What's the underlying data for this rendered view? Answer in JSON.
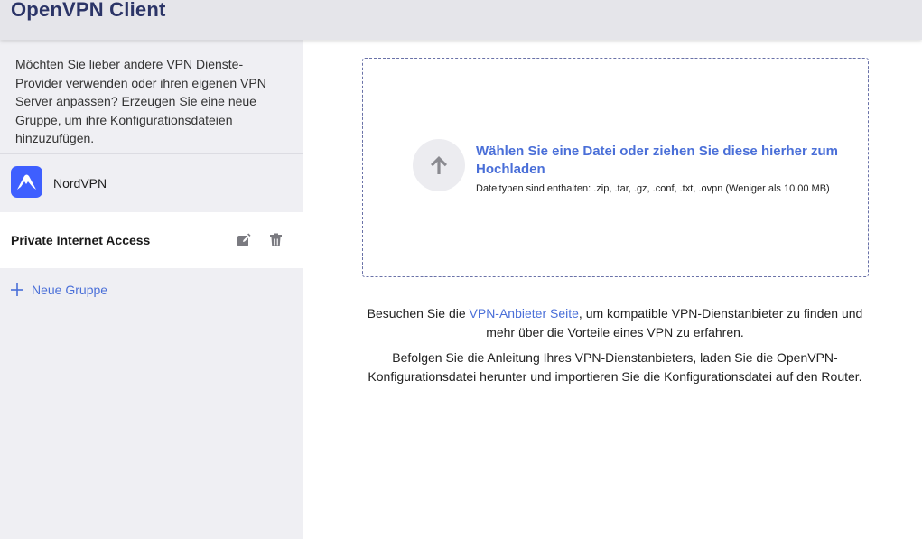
{
  "app": {
    "title": "OpenVPN Client"
  },
  "sidebar": {
    "intro": "Möchten Sie lieber andere VPN Dienste-Provider verwenden oder ihren eigenen VPN Server anpassen? Erzeugen Sie eine neue Gruppe, um ihre Konfigurationsdateien hinzuzufügen.",
    "groups": [
      {
        "label": "NordVPN",
        "icon": "nordvpn-logo-icon",
        "selected": false
      },
      {
        "label": "Private Internet Access",
        "selected": true,
        "actions": [
          "edit-icon",
          "trash-icon"
        ]
      }
    ],
    "new_group_label": "Neue Gruppe"
  },
  "upload": {
    "title": "Wählen Sie eine Datei oder ziehen Sie diese hierher zum Hochladen",
    "filetypes": "Dateitypen sind enthalten: .zip, .tar, .gz, .conf, .txt, .ovpn (Weniger als 10.00 MB)",
    "icon": "arrow-up-icon"
  },
  "info": {
    "line1_prefix": "Besuchen Sie die ",
    "line1_link": "VPN-Anbieter Seite",
    "line1_suffix": ", um kompatible VPN-Dienstanbieter zu finden und mehr über die Vorteile eines VPN zu erfahren.",
    "line2": "Befolgen Sie die Anleitung Ihres VPN-Dienstanbieters, laden Sie die OpenVPN-Konfigurationsdatei herunter und importieren Sie die Konfigurationsdatei auf den Router."
  },
  "colors": {
    "accent": "#4a6fd8",
    "title": "#2b3467",
    "nordvpn": "#3e5fff",
    "sidebar_bg": "#efeff3",
    "header_bg": "#e5e5ea"
  }
}
